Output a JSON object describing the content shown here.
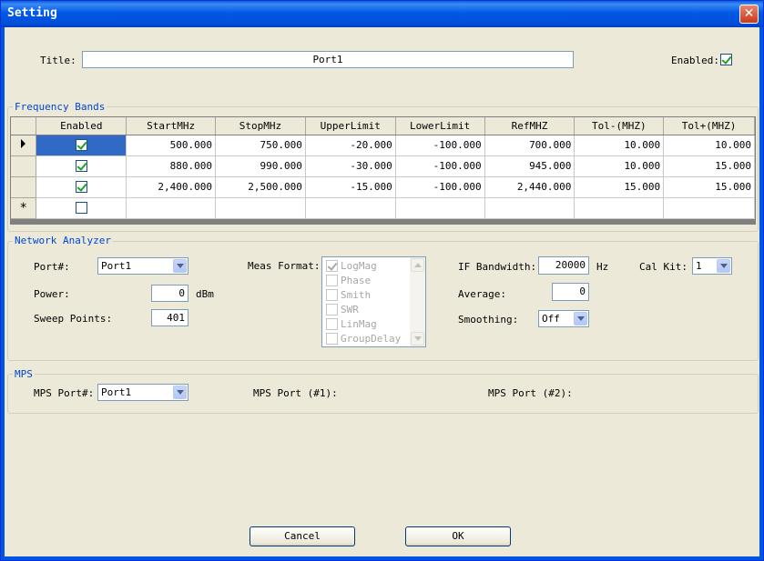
{
  "window": {
    "title": "Setting"
  },
  "general": {
    "title_label": "Title:",
    "title_value": "Port1",
    "enabled_label": "Enabled:",
    "enabled": true
  },
  "frequency_bands": {
    "group_title": "Frequency Bands",
    "columns": [
      "Enabled",
      "StartMHz",
      "StopMHz",
      "UpperLimit",
      "LowerLimit",
      "RefMHZ",
      "Tol-(MHZ)",
      "Tol+(MHZ)"
    ],
    "rows": [
      {
        "enabled": true,
        "start": "500.000",
        "stop": "750.000",
        "upper": "-20.000",
        "lower": "-100.000",
        "ref": "700.000",
        "tol_minus": "10.000",
        "tol_plus": "10.000"
      },
      {
        "enabled": true,
        "start": "880.000",
        "stop": "990.000",
        "upper": "-30.000",
        "lower": "-100.000",
        "ref": "945.000",
        "tol_minus": "10.000",
        "tol_plus": "15.000"
      },
      {
        "enabled": true,
        "start": "2,400.000",
        "stop": "2,500.000",
        "upper": "-15.000",
        "lower": "-100.000",
        "ref": "2,440.000",
        "tol_minus": "15.000",
        "tol_plus": "15.000"
      }
    ],
    "new_row_marker": "*"
  },
  "network_analyzer": {
    "group_title": "Network Analyzer",
    "port_label": "Port#:",
    "port_value": "Port1",
    "power_label": "Power:",
    "power_value": "0",
    "power_unit": "dBm",
    "sweep_label": "Sweep Points:",
    "sweep_value": "401",
    "meas_format_label": "Meas Format:",
    "meas_formats": [
      {
        "label": "LogMag",
        "checked": true
      },
      {
        "label": "Phase",
        "checked": false
      },
      {
        "label": "Smith",
        "checked": false
      },
      {
        "label": "SWR",
        "checked": false
      },
      {
        "label": "LinMag",
        "checked": false
      },
      {
        "label": "GroupDelay",
        "checked": false
      }
    ],
    "if_bw_label": "IF Bandwidth:",
    "if_bw_value": "20000",
    "if_bw_unit": "Hz",
    "cal_kit_label": "Cal Kit:",
    "cal_kit_value": "1",
    "average_label": "Average:",
    "average_value": "0",
    "smoothing_label": "Smoothing:",
    "smoothing_value": "Off"
  },
  "mps": {
    "group_title": "MPS",
    "port_label": "MPS Port#:",
    "port_value": "Port1",
    "port1_label": "MPS Port (#1):",
    "port2_label": "MPS Port (#2):"
  },
  "buttons": {
    "cancel": "Cancel",
    "ok": "OK"
  }
}
